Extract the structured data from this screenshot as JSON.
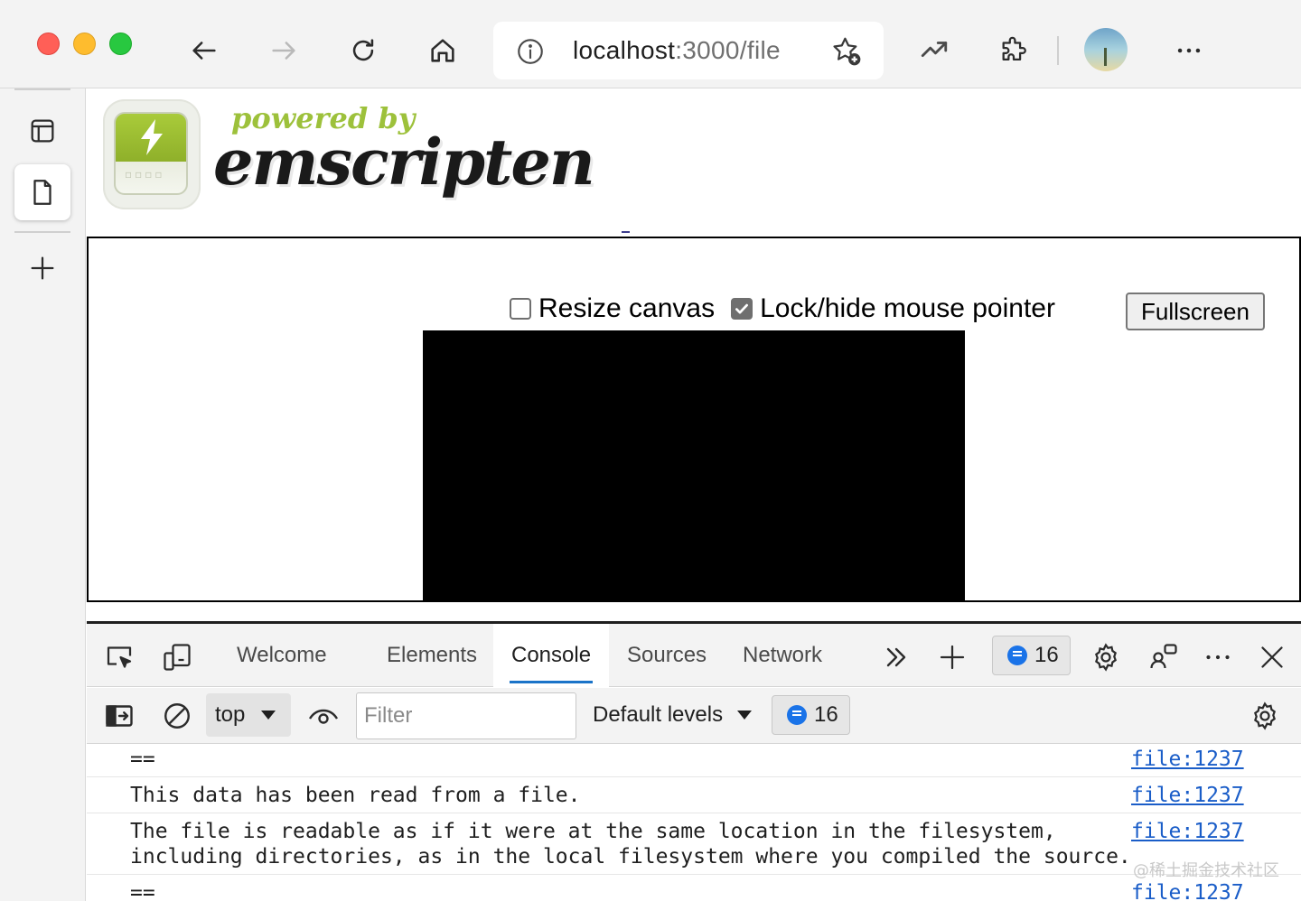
{
  "browser": {
    "address": {
      "host": "localhost",
      "path": ":3000/file"
    },
    "colors": {
      "chrome_bg": "#f3f3f3",
      "link": "#1a5dc8",
      "accent": "#1a73c8"
    }
  },
  "page": {
    "logo": {
      "powered_by": "powered by",
      "name": "emscripten"
    },
    "controls": {
      "resize_canvas": {
        "label": "Resize canvas",
        "checked": false
      },
      "lock_pointer": {
        "label": "Lock/hide mouse pointer",
        "checked": true
      },
      "fullscreen_label": "Fullscreen"
    }
  },
  "devtools": {
    "tabs": [
      {
        "label": "Welcome",
        "active": false
      },
      {
        "label": "Elements",
        "active": false
      },
      {
        "label": "Console",
        "active": true
      },
      {
        "label": "Sources",
        "active": false
      },
      {
        "label": "Network",
        "active": false
      }
    ],
    "issues_count": "16",
    "toolbar": {
      "context": "top",
      "filter_placeholder": "Filter",
      "levels": "Default levels",
      "message_count": "16"
    },
    "console": [
      {
        "message": "==",
        "source": "file:1237"
      },
      {
        "message": "This data has been read from a file.",
        "source": "file:1237"
      },
      {
        "message": "The file is readable as if it were at the same location in the filesystem,\nincluding directories, as in the local filesystem where you compiled the source.",
        "source": "file:1237"
      },
      {
        "message": "==",
        "source": "file:1237"
      }
    ]
  },
  "watermark": "@稀土掘金技术社区"
}
